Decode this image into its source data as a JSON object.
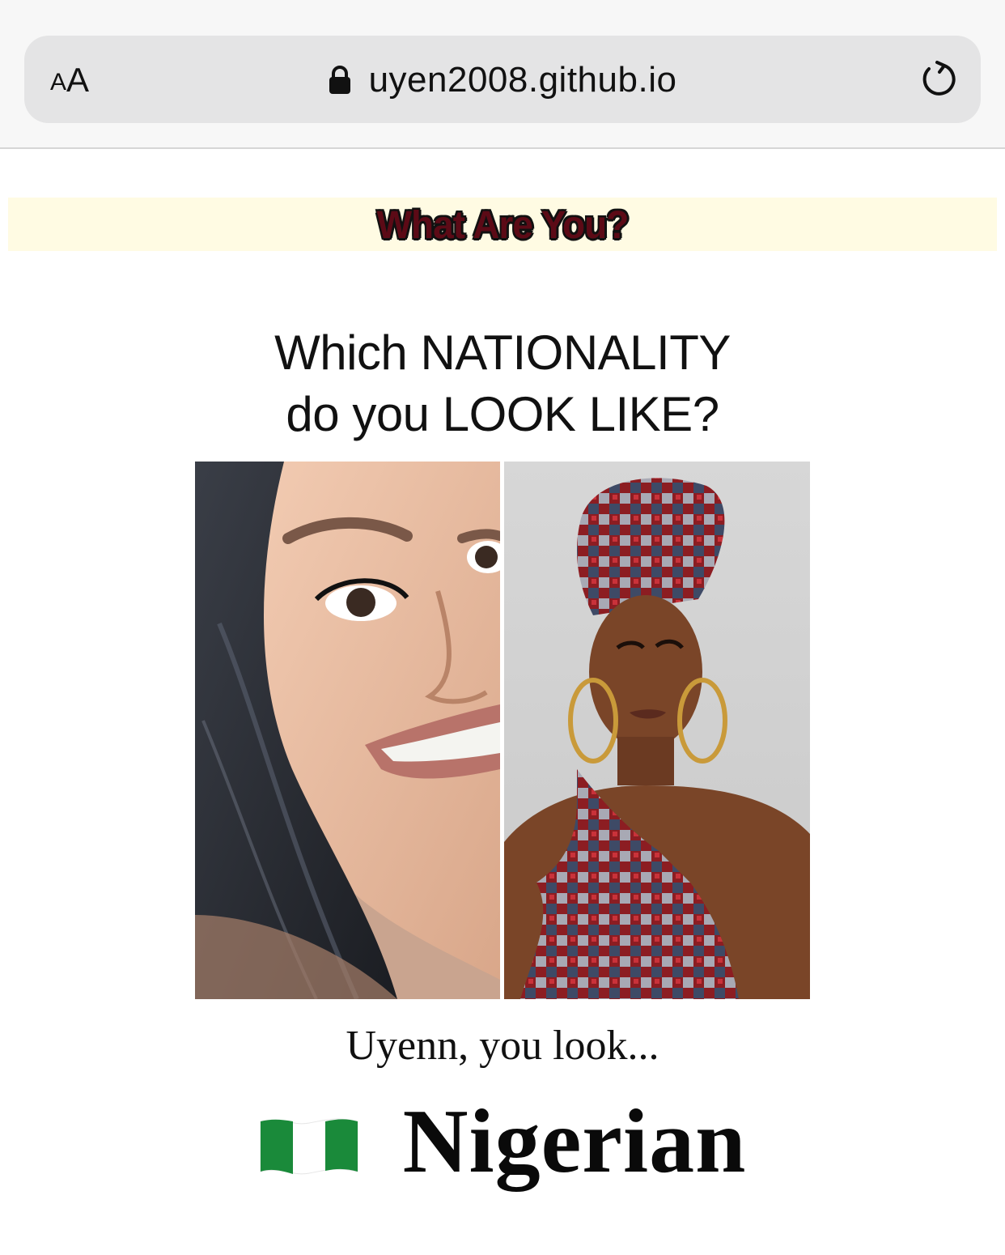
{
  "browser": {
    "text_size_button": {
      "small": "A",
      "large": "A"
    },
    "url": "uyen2008.github.io",
    "icons": {
      "lock": "lock-icon",
      "reload": "reload-icon"
    }
  },
  "page": {
    "banner_title": "What Are You?",
    "headline_line1": "Which NATIONALITY",
    "headline_line2": "do you LOOK LIKE?",
    "result_intro": "Uyenn, you look...",
    "result_flag": "nigeria-flag-icon",
    "result_nationality": "Nigerian"
  },
  "colors": {
    "banner_bg": "#fffbe3",
    "banner_text": "#5c0a16",
    "flag_green": "#1a8a3a",
    "address_bar": "#e4e4e5"
  }
}
